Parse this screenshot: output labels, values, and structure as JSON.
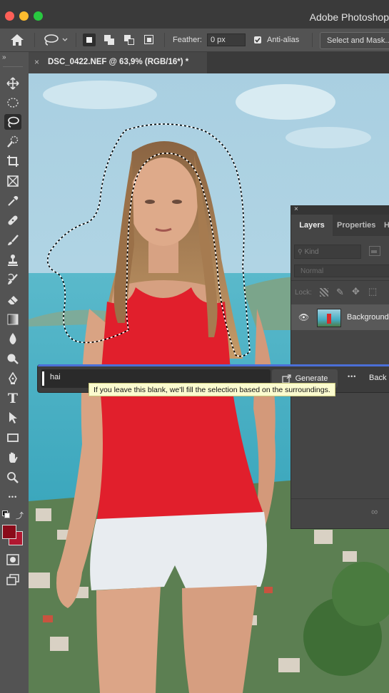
{
  "app": {
    "title": "Adobe Photoshop"
  },
  "options": {
    "feather_label": "Feather:",
    "feather_value": "0 px",
    "antialias_label": "Anti-alias",
    "antialias_checked": true,
    "select_mask_label": "Select and Mask..."
  },
  "document": {
    "tab_title": "DSC_0422.NEF @ 63,9% (RGB/16*) *",
    "close_glyph": "×"
  },
  "toolbar": {
    "expand_glyph": "»",
    "more_glyph": "•••"
  },
  "layers_panel": {
    "close_glyph": "×",
    "tabs": [
      "Layers",
      "Properties",
      "H"
    ],
    "active_tab": "Layers",
    "kind_placeholder": "Kind",
    "blend_mode": "Normal",
    "lock_label": "Lock:",
    "layers": [
      {
        "name": "Background",
        "visible": true
      }
    ],
    "footer_glyph": "∞"
  },
  "generative_fill": {
    "prompt_value": "hai",
    "generate_label": "Generate",
    "more_glyph": "•••",
    "back_label": "Back",
    "tooltip": "If you leave this blank, we'll fill the selection based on the surroundings."
  },
  "colors": {
    "foreground": "#8a0b1a",
    "background": "#b01730",
    "accent_bar": "#4b6fd8",
    "tooltip_bg": "#fbfbcf"
  }
}
